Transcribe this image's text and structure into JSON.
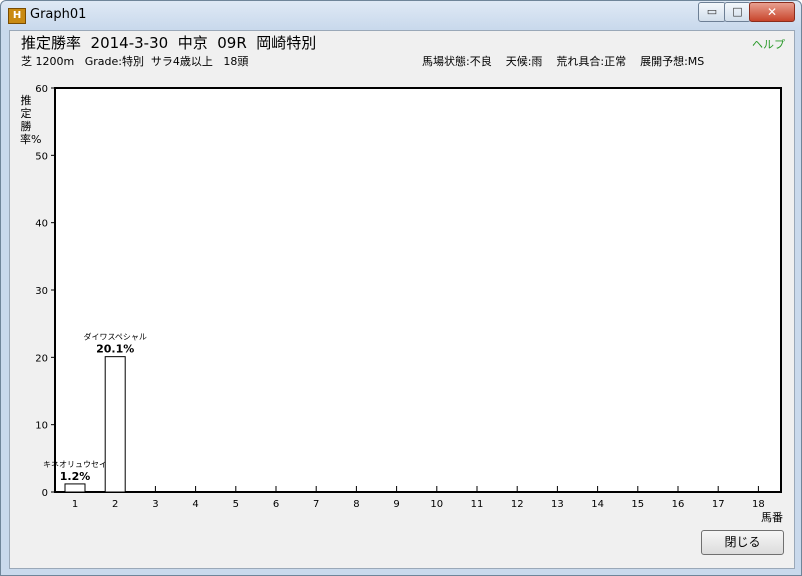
{
  "window": {
    "title": "Graph01",
    "app_icon": "app-icon",
    "min_glyph": "▭",
    "max_glyph": "□",
    "close_glyph": "✕"
  },
  "header": {
    "title": "推定勝率  2014-3-30  中京  09R  岡崎特別",
    "subtitle": "芝 1200m   Grade:特別  サラ4歳以上   18頭",
    "conditions": "馬場状態:不良    天候:雨    荒れ具合:正常    展開予想:MS",
    "help_label": "ヘルプ"
  },
  "footer": {
    "close_label": "閉じる"
  },
  "chart_data": {
    "type": "bar",
    "title": "推定勝率",
    "ylabel": "推定勝率%",
    "xlabel": "馬番",
    "ylim": [
      0,
      60
    ],
    "yticks": [
      0,
      10,
      20,
      30,
      40,
      50,
      60
    ],
    "grid": false,
    "categories": [
      "1",
      "2",
      "3",
      "4",
      "5",
      "6",
      "7",
      "8",
      "9",
      "10",
      "11",
      "12",
      "13",
      "14",
      "15",
      "16",
      "17",
      "18"
    ],
    "values": [
      1.2,
      20.1,
      null,
      null,
      null,
      null,
      null,
      null,
      null,
      null,
      null,
      null,
      null,
      null,
      null,
      null,
      null,
      null
    ],
    "bar_labels": [
      {
        "horse_number": "1",
        "name": "キネオリュウセイ",
        "value_text": "1.2%"
      },
      {
        "horse_number": "2",
        "name": "ダイワスペシャル",
        "value_text": "20.1%"
      }
    ]
  }
}
